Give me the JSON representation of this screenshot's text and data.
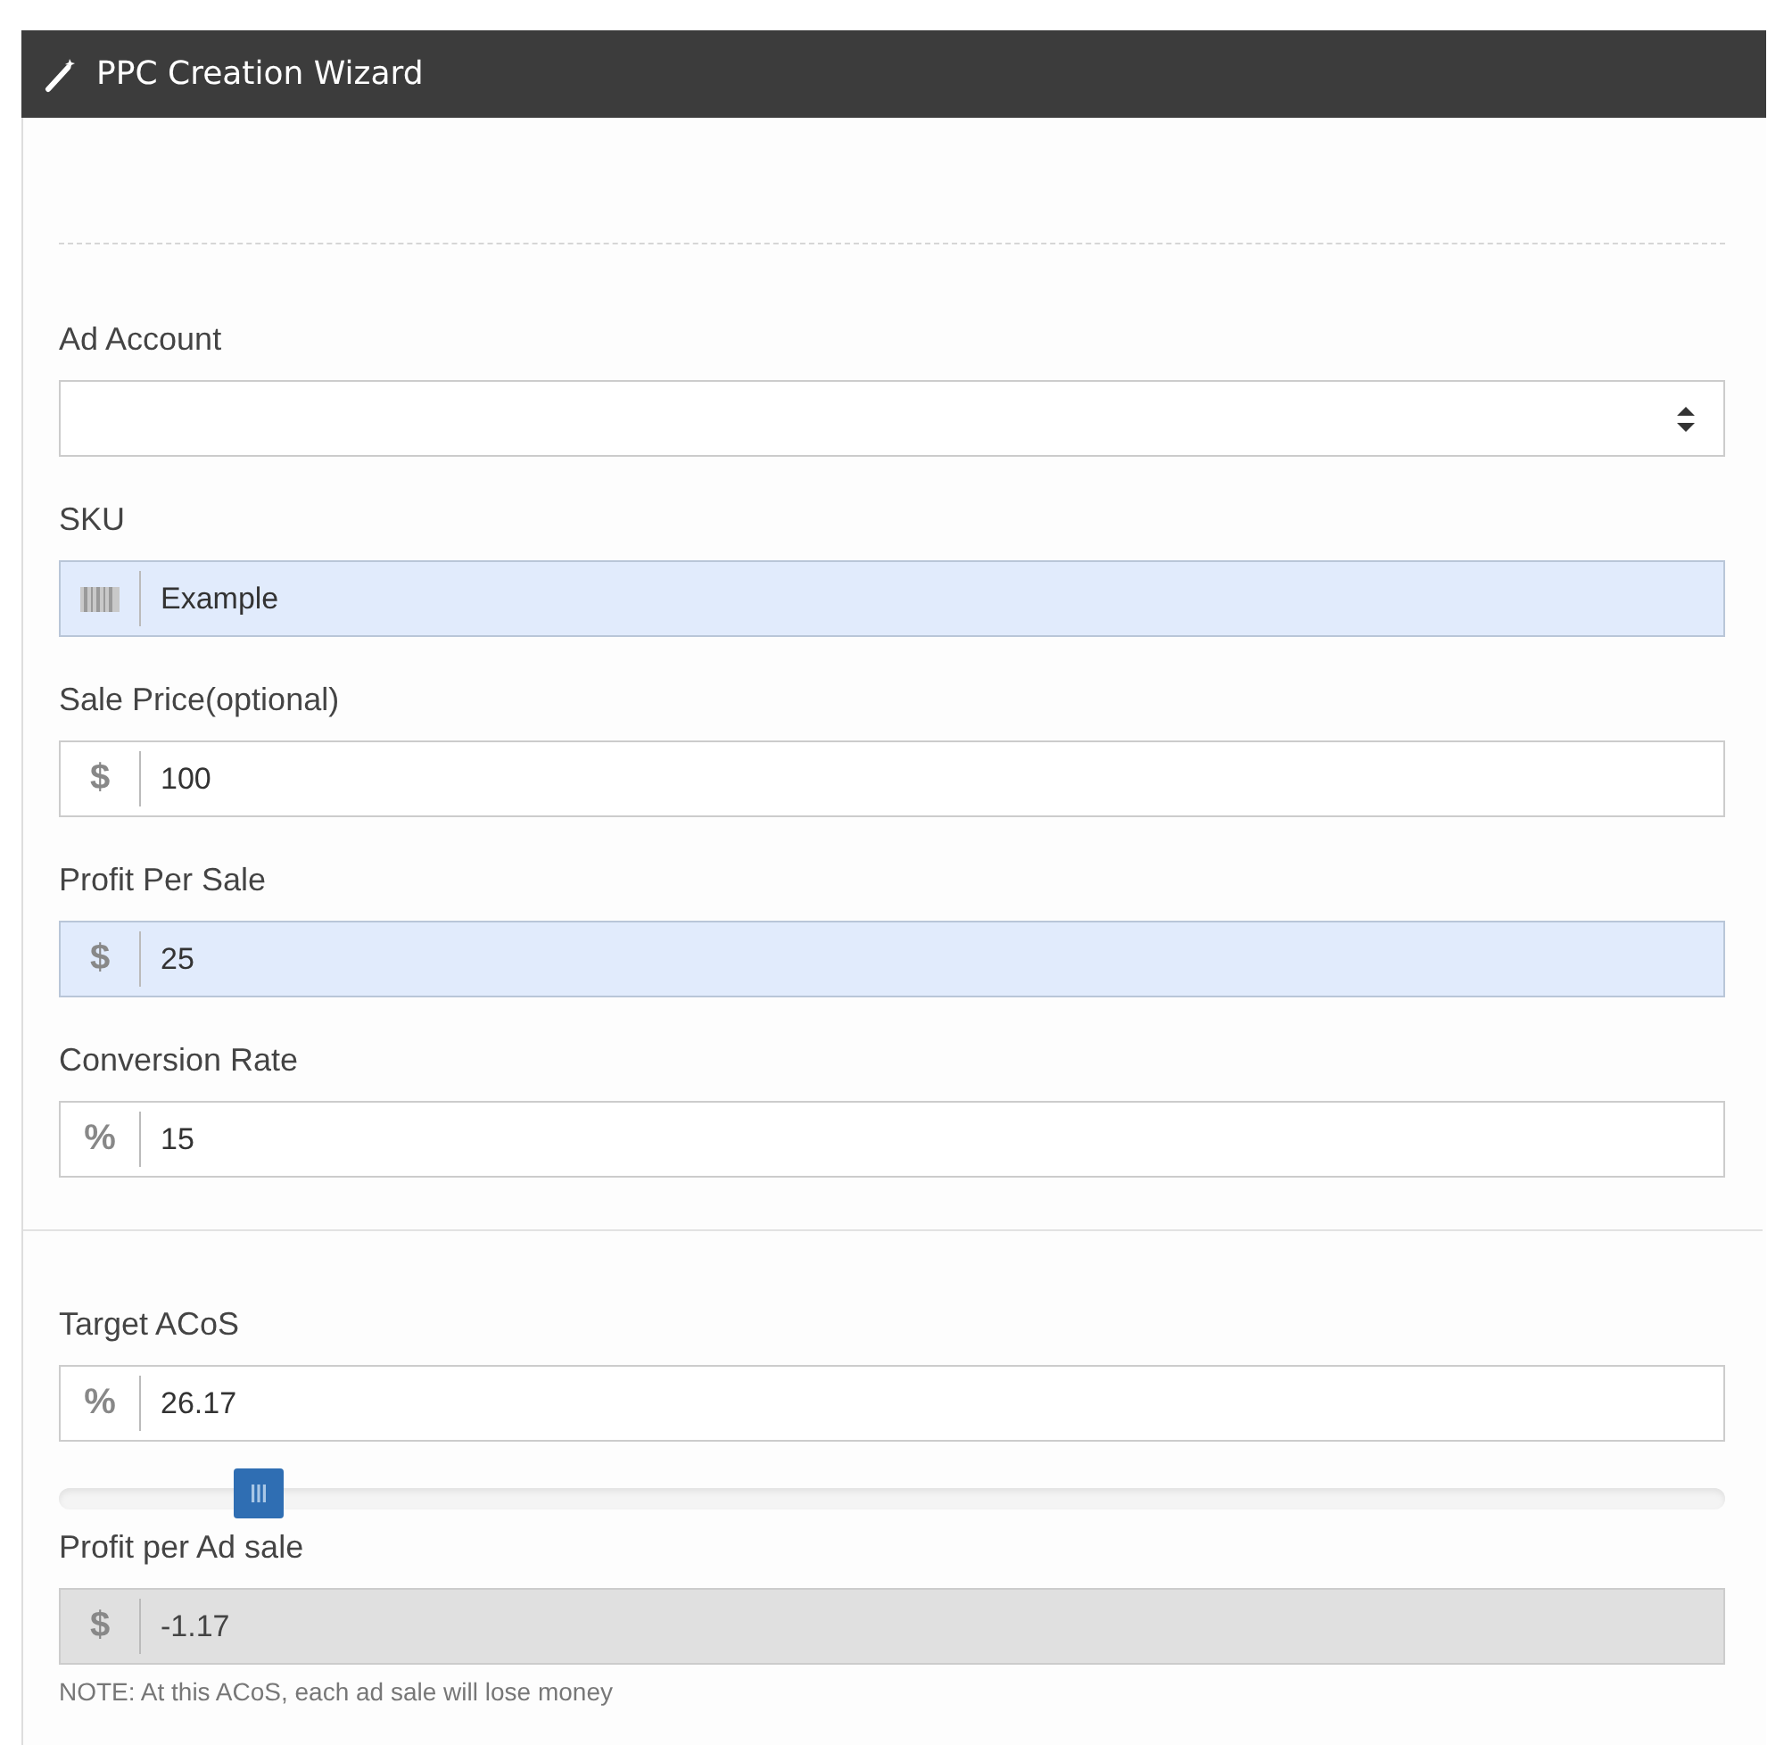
{
  "window": {
    "title": "PPC Creation Wizard"
  },
  "sections": [
    {
      "items": [
        {
          "kind": "select",
          "label": "Ad Account"
        },
        {
          "kind": "input",
          "label": "SKU",
          "addon": {
            "kind": "barcode"
          },
          "value": "Example",
          "highlighted": true,
          "disabled": false
        },
        {
          "kind": "input",
          "label": "Sale Price(optional)",
          "addon": {
            "kind": "text",
            "text": "$"
          },
          "value": "100",
          "highlighted": false,
          "disabled": false
        },
        {
          "kind": "input",
          "label": "Profit Per Sale",
          "addon": {
            "kind": "text",
            "text": "$"
          },
          "value": "25",
          "highlighted": true,
          "disabled": false
        },
        {
          "kind": "input",
          "label": "Conversion Rate",
          "addon": {
            "kind": "text",
            "text": "%"
          },
          "value": "15",
          "highlighted": false,
          "disabled": false
        }
      ]
    },
    {
      "items": [
        {
          "kind": "input",
          "label": "Target ACoS",
          "addon": {
            "kind": "text",
            "text": "%"
          },
          "value": "26.17",
          "highlighted": false,
          "disabled": false
        },
        {
          "kind": "slider",
          "level": 0.12
        },
        {
          "kind": "input",
          "label": "Profit per Ad sale",
          "addon": {
            "kind": "text",
            "text": "$"
          },
          "value": "-1.17",
          "highlighted": false,
          "disabled": true
        },
        {
          "kind": "note",
          "text": "NOTE: At this ACoS, each ad sale will lose money"
        }
      ]
    }
  ]
}
